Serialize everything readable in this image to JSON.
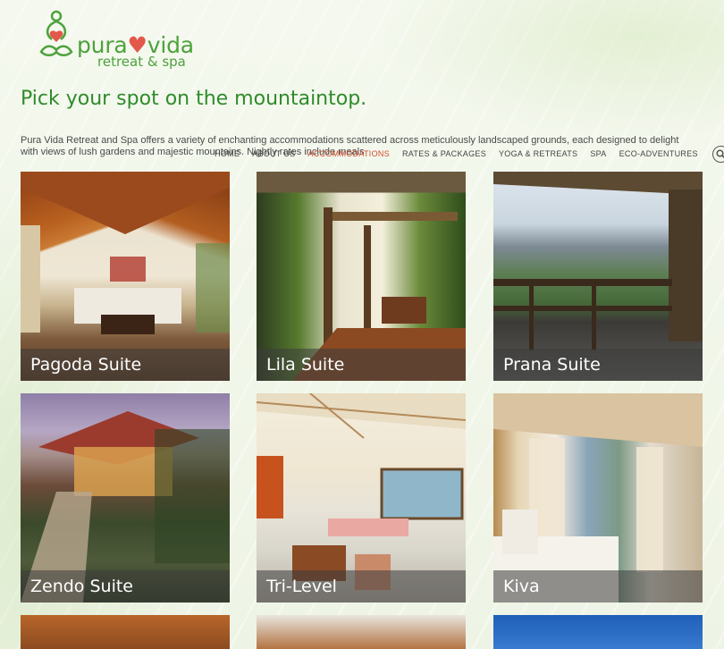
{
  "brand": {
    "name_part1": "pura",
    "name_heart": "♥",
    "name_part2": "vida",
    "tagline": "retreat & spa",
    "logo_icon": "yoga-figure-icon"
  },
  "page": {
    "heading": "Pick your spot on the mountaintop.",
    "intro": "Pura Vida Retreat and Spa offers a variety of enchanting accommodations scattered across meticulously landscaped grounds, each designed to delight with views of lush gardens and majestic mountains. Nightly rates include meals"
  },
  "nav": {
    "items": [
      {
        "label": "HOME",
        "active": false
      },
      {
        "label": "ABOUT US",
        "active": false
      },
      {
        "label": "ACCOMMODATIONS",
        "active": true
      },
      {
        "label": "RATES & PACKAGES",
        "active": false
      },
      {
        "label": "YOGA & RETREATS",
        "active": false
      },
      {
        "label": "SPA",
        "active": false
      },
      {
        "label": "ECO-ADVENTURES",
        "active": false
      }
    ],
    "search_icon": "search-icon"
  },
  "rooms": [
    {
      "name": "Pagoda Suite"
    },
    {
      "name": "Lila Suite"
    },
    {
      "name": "Prana Suite"
    },
    {
      "name": "Zendo Suite"
    },
    {
      "name": "Tri-Level"
    },
    {
      "name": "Kiva"
    }
  ],
  "colors": {
    "brand_green": "#4da23c",
    "heading_green": "#2f8b2b",
    "accent_red": "#d24a2e"
  }
}
